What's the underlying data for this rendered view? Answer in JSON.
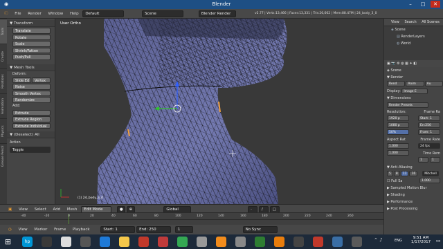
{
  "window": {
    "title": "Blender",
    "minimize": "–",
    "maximize": "□",
    "close": "✕"
  },
  "infobar": {
    "menus": [
      "File",
      "Render",
      "Window",
      "Help"
    ],
    "screen": "Default",
    "scene": "Scene",
    "engine": "Blender Render",
    "stats": "v2.77 | Verts:13,466 | Faces:13,331 | Tris:26,662 | Mem:88.47M | 24_body_3_0"
  },
  "tabs": [
    "Tools",
    "Create",
    "Relations",
    "Animation",
    "Physics",
    "Grease Pencil"
  ],
  "toolshelf": {
    "transform_header": "▼ Transform",
    "transform_buttons": [
      "Translate",
      "Rotate",
      "Scale",
      "Shrink/Fatten",
      "Push/Pull"
    ],
    "mesh_tools_header": "▼ Mesh Tools",
    "deform_label": "Deform:",
    "slide_edge": "Slide Ed",
    "vertex": "Vertex",
    "noise": "Noise",
    "smooth_vertex": "Smooth Vertex",
    "randomize": "Randomize",
    "add_label": "Add:",
    "extrude": "Extrude",
    "extrude_region": "Extrude Region",
    "extrude_individual": "Extrude Individual",
    "operator_header": "▼ (Deselect) All",
    "action_label": "Action",
    "action_value": "Toggle"
  },
  "viewport": {
    "view_label": "User Ortho",
    "object_label": "(1) 24_body_3_0"
  },
  "viewport_header": {
    "menus": [
      "View",
      "Select",
      "Add",
      "Mesh"
    ],
    "mode": "Edit Mode",
    "pivot": "Global"
  },
  "outliner": {
    "menus": [
      "View",
      "Search",
      "All Scenes"
    ],
    "items": [
      "Scene",
      "RenderLayers",
      "World"
    ]
  },
  "properties": {
    "scene_label": "Scene",
    "render_header": "▼ Render",
    "render_buttons": [
      "Rend",
      "Anim",
      "Au"
    ],
    "display_label": "Display:",
    "display_value": "Image E",
    "dimensions_header": "▼ Dimensions",
    "render_presets": "Render Presets",
    "resolution_label": "Resolution:",
    "frame_range_label": "Frame Ra",
    "res_x": "1920 p",
    "res_y": "1080 p",
    "res_pct": "50%",
    "start": "Start: 1",
    "end": "En:250",
    "frame": "Fram: 1",
    "aspect_label": "Aspect Rat",
    "fps_label": "Frame Rate",
    "aspect_x": "1.000",
    "aspect_y": "1.000",
    "fps": "24 fps",
    "time_rem": "Time Rem",
    "tr_a": "1",
    "tr_b": "1",
    "aa_header": "▼ Anti-Aliasing",
    "aa_values": [
      "5",
      "8",
      "11",
      "16"
    ],
    "aa_filter": "Mitchell",
    "full_sample": "Full Sa",
    "aa_size": "1.000",
    "sampled_motion_blur": "▶ Sampled Motion Blur",
    "shading": "▶ Shading",
    "performance": "▶ Performance",
    "post_processing": "▶ Post Processing"
  },
  "timeline": {
    "ticks": [
      "-40",
      "-20",
      "0",
      "20",
      "40",
      "60",
      "80",
      "100",
      "120",
      "140",
      "160",
      "180",
      "200",
      "220",
      "240",
      "260"
    ],
    "menus": [
      "View",
      "Marker",
      "Frame",
      "Playback"
    ],
    "start": "Start:",
    "start_value": "1",
    "end": "End:",
    "end_value": "250",
    "current": "1",
    "sync": "No Sync"
  },
  "taskbar": {
    "lang": "ENG",
    "time": "9:51 AM",
    "date": "1/17/2017"
  }
}
